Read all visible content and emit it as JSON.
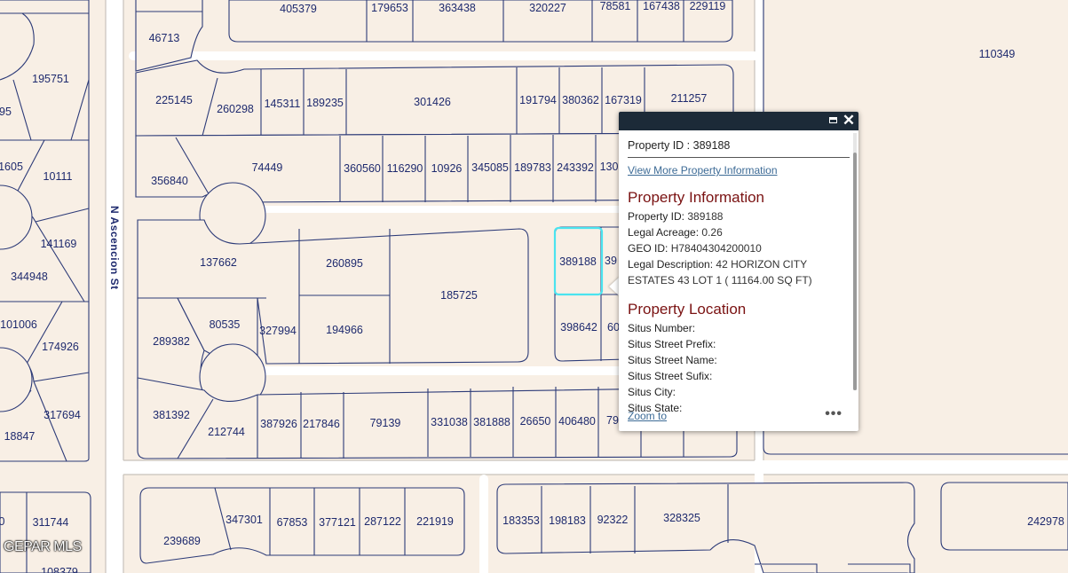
{
  "map": {
    "street_label": "N Ascencion St",
    "watermark": "GEPAR MLS",
    "selected_parcel": "389188",
    "parcels": [
      "405379",
      "179653",
      "363438",
      "320227",
      "78581",
      "167438",
      "229119",
      "46713",
      "195751",
      "110349",
      "225145",
      "260298",
      "145311",
      "189235",
      "301426",
      "191794",
      "380362",
      "167319",
      "211257",
      "95",
      "1605",
      "10111",
      "356840",
      "74449",
      "360560",
      "116290",
      "10926",
      "345085",
      "189783",
      "243392",
      "130",
      "141169",
      "344948",
      "137662",
      "260895",
      "185725",
      "389188",
      "39",
      "101006",
      "174926",
      "289382",
      "80535",
      "327994",
      "194966",
      "398642",
      "60",
      "317694",
      "18847",
      "381392",
      "212744",
      "387926",
      "217846",
      "79139",
      "331038",
      "381888",
      "26650",
      "406480",
      "79",
      "0",
      "311744",
      "108379",
      "239689",
      "347301",
      "67853",
      "377121",
      "287122",
      "221919",
      "183353",
      "198183",
      "92322",
      "328325",
      "242978"
    ]
  },
  "popup": {
    "title": "Property ID : 389188",
    "more_link": "View More Property Information",
    "info_section_title": "Property Information",
    "info_fields": [
      {
        "key": "Property ID:",
        "value": "389188"
      },
      {
        "key": "Legal Acreage:",
        "value": "0.26"
      },
      {
        "key": "GEO ID:",
        "value": "H78404304200010"
      },
      {
        "key": "Legal Description:",
        "value": "42 HORIZON CITY ESTATES 43 LOT 1 ( 11164.00 SQ FT)"
      }
    ],
    "location_section_title": "Property Location",
    "location_fields": [
      {
        "key": "Situs Number:",
        "value": ""
      },
      {
        "key": "Situs Street Prefix:",
        "value": ""
      },
      {
        "key": "Situs Street Name:",
        "value": ""
      },
      {
        "key": "Situs Street Sufix:",
        "value": ""
      },
      {
        "key": "Situs City:",
        "value": ""
      },
      {
        "key": "Situs State:",
        "value": ""
      }
    ],
    "zoom_to": "Zoom to",
    "more_menu": "•••",
    "close_glyph": "✕"
  }
}
